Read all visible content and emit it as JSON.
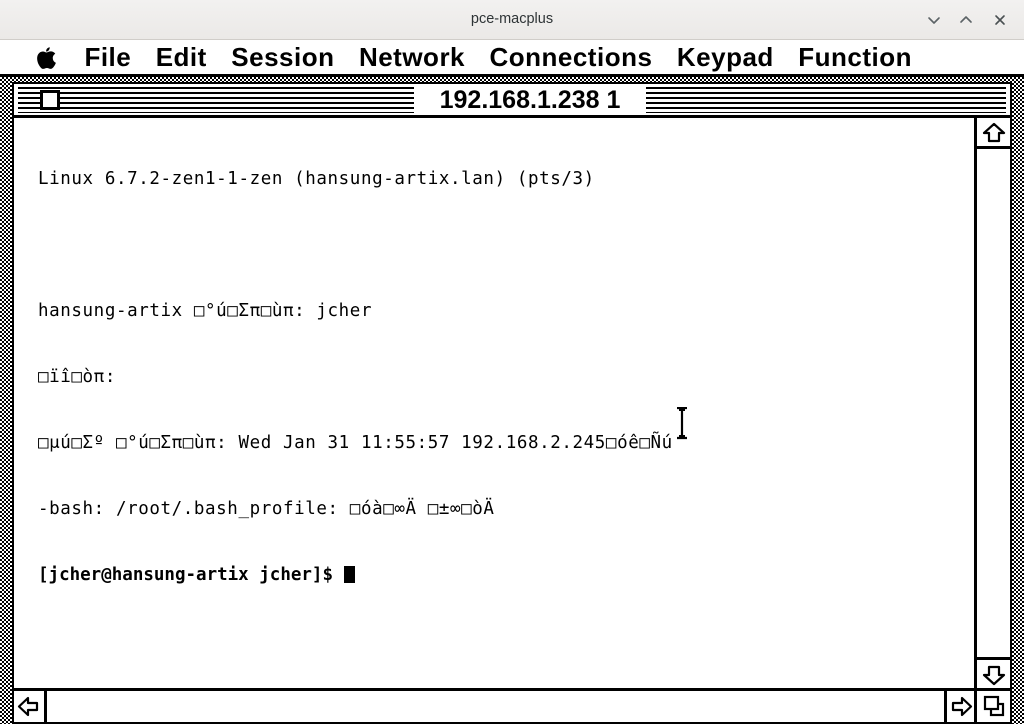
{
  "host_window": {
    "title": "pce-macplus",
    "buttons": [
      {
        "name": "minimize",
        "glyph": "chevron-down"
      },
      {
        "name": "maximize",
        "glyph": "chevron-up"
      },
      {
        "name": "close",
        "glyph": "x"
      }
    ]
  },
  "mac_menubar": {
    "apple_icon": "apple-icon",
    "items": [
      {
        "label": "File"
      },
      {
        "label": "Edit"
      },
      {
        "label": "Session"
      },
      {
        "label": "Network"
      },
      {
        "label": "Connections"
      },
      {
        "label": "Keypad"
      },
      {
        "label": "Function"
      }
    ]
  },
  "terminal_window": {
    "title": "192.168.1.238 1",
    "close_box": "close-box",
    "lines": [
      {
        "text": "Linux 6.7.2-zen1-1-zen (hansung-artix.lan) (pts/3)",
        "bold": false
      },
      {
        "text": "",
        "bold": false
      },
      {
        "text": "hansung-artix □°ú□Σπ□ùπ: jcher",
        "bold": false
      },
      {
        "text": "□ïî□òπ:",
        "bold": false
      },
      {
        "text": "□μú□Σº □°ú□Σπ□ùπ: Wed Jan 31 11:55:57 192.168.2.245□óê□Ñú",
        "bold": false
      },
      {
        "text": "-bash: /root/.bash_profile: □óà□∞Ä □±∞□òÄ",
        "bold": false
      },
      {
        "text": "[jcher@hansung-artix jcher]$ ",
        "bold": true
      }
    ],
    "cursor": "block-cursor",
    "scrollbars": {
      "up_arrow": "scroll-up-arrow",
      "down_arrow": "scroll-down-arrow",
      "left_arrow": "scroll-left-arrow",
      "right_arrow": "scroll-right-arrow",
      "grow_box": "resize-grow-box"
    }
  },
  "pointer": {
    "type": "i-beam-cursor"
  },
  "colors": {
    "background": "#ffffff",
    "foreground": "#000000",
    "host_titlebar": "#f2f1f0",
    "host_title_text": "#2e3436"
  }
}
